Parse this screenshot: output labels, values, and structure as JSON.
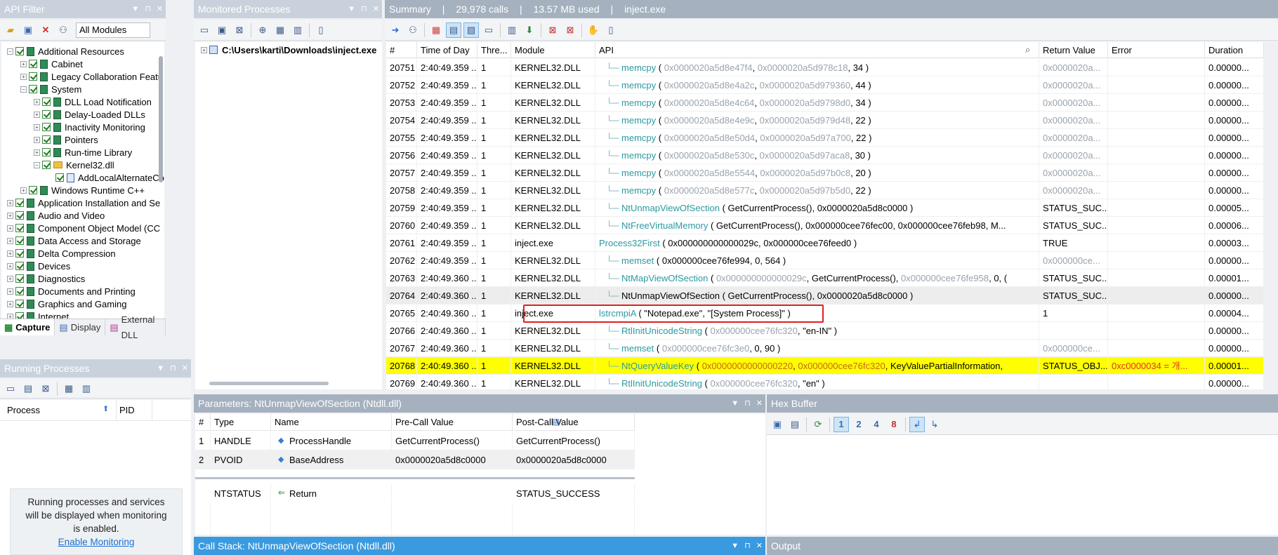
{
  "panels": {
    "api_filter": "API Filter",
    "monitored": "Monitored Processes",
    "running": "Running Processes",
    "params": "Parameters: NtUnmapViewOfSection (Ntdll.dll)",
    "hex": "Hex Buffer",
    "callstack": "Call Stack: NtUnmapViewOfSection (Ntdll.dll)",
    "output": "Output"
  },
  "summary": {
    "label": "Summary",
    "calls": "29,978 calls",
    "mem": "13.57 MB used",
    "process": "inject.exe"
  },
  "modules_select": "All Modules",
  "api_tree": [
    {
      "label": "Additional Resources",
      "kind": "book",
      "indent": 0,
      "exp": "−"
    },
    {
      "label": "Cabinet",
      "kind": "book",
      "indent": 1,
      "exp": "+"
    },
    {
      "label": "Legacy Collaboration Featu",
      "kind": "book",
      "indent": 1,
      "exp": "+"
    },
    {
      "label": "System",
      "kind": "book",
      "indent": 1,
      "exp": "−"
    },
    {
      "label": "DLL Load Notification",
      "kind": "book",
      "indent": 2,
      "exp": "+"
    },
    {
      "label": "Delay-Loaded DLLs",
      "kind": "book",
      "indent": 2,
      "exp": "+"
    },
    {
      "label": "Inactivity Monitoring",
      "kind": "book",
      "indent": 2,
      "exp": "+"
    },
    {
      "label": "Pointers",
      "kind": "book",
      "indent": 2,
      "exp": "+"
    },
    {
      "label": "Run-time Library",
      "kind": "book",
      "indent": 2,
      "exp": "+"
    },
    {
      "label": "Kernel32.dll",
      "kind": "folder",
      "indent": 2,
      "exp": "−"
    },
    {
      "label": "AddLocalAlternateCo",
      "kind": "doc",
      "indent": 3,
      "exp": ""
    },
    {
      "label": "Windows Runtime C++",
      "kind": "book",
      "indent": 1,
      "exp": "+"
    },
    {
      "label": "Application Installation and Se",
      "kind": "book",
      "indent": 0,
      "exp": "+"
    },
    {
      "label": "Audio and Video",
      "kind": "book",
      "indent": 0,
      "exp": "+"
    },
    {
      "label": "Component Object Model (CC",
      "kind": "book",
      "indent": 0,
      "exp": "+"
    },
    {
      "label": "Data Access and Storage",
      "kind": "book",
      "indent": 0,
      "exp": "+"
    },
    {
      "label": "Delta Compression",
      "kind": "book",
      "indent": 0,
      "exp": "+"
    },
    {
      "label": "Devices",
      "kind": "book",
      "indent": 0,
      "exp": "+"
    },
    {
      "label": "Diagnostics",
      "kind": "book",
      "indent": 0,
      "exp": "+"
    },
    {
      "label": "Documents and Printing",
      "kind": "book",
      "indent": 0,
      "exp": "+"
    },
    {
      "label": "Graphics and Gaming",
      "kind": "book",
      "indent": 0,
      "exp": "+"
    },
    {
      "label": "Internet",
      "kind": "book",
      "indent": 0,
      "exp": "+"
    }
  ],
  "left_tabs": [
    "Capture",
    "Display",
    "External DLL"
  ],
  "monitored_item": "C:\\Users\\karti\\Downloads\\inject.exe",
  "running": {
    "col_process": "Process",
    "col_pid": "PID",
    "message": "Running processes and services will be displayed when monitoring is enabled.",
    "link": "Enable Monitoring"
  },
  "columns": [
    "#",
    "Time of Day",
    "Thre...",
    "Module",
    "API",
    "Return Value",
    "Error",
    "Duration"
  ],
  "rows": [
    {
      "n": "20751",
      "t": "2:40:49.359 ...",
      "th": "1",
      "mod": "KERNEL32.DLL",
      "fn": "memcpy",
      "args": [
        [
          "0x0000020a5d8e47f4",
          "g"
        ],
        [
          "0x0000020a5d978c18",
          "g"
        ],
        [
          "34",
          "k"
        ]
      ],
      "ret": "0x0000020a...",
      "err": "",
      "dur": "0.00000...",
      "style": "teal",
      "nested": true
    },
    {
      "n": "20752",
      "t": "2:40:49.359 ...",
      "th": "1",
      "mod": "KERNEL32.DLL",
      "fn": "memcpy",
      "args": [
        [
          "0x0000020a5d8e4a2c",
          "g"
        ],
        [
          "0x0000020a5d979360",
          "g"
        ],
        [
          "44",
          "k"
        ]
      ],
      "ret": "0x0000020a...",
      "err": "",
      "dur": "0.00000...",
      "style": "teal",
      "nested": true
    },
    {
      "n": "20753",
      "t": "2:40:49.359 ...",
      "th": "1",
      "mod": "KERNEL32.DLL",
      "fn": "memcpy",
      "args": [
        [
          "0x0000020a5d8e4c64",
          "g"
        ],
        [
          "0x0000020a5d9798d0",
          "g"
        ],
        [
          "34",
          "k"
        ]
      ],
      "ret": "0x0000020a...",
      "err": "",
      "dur": "0.00000...",
      "style": "teal",
      "nested": true
    },
    {
      "n": "20754",
      "t": "2:40:49.359 ...",
      "th": "1",
      "mod": "KERNEL32.DLL",
      "fn": "memcpy",
      "args": [
        [
          "0x0000020a5d8e4e9c",
          "g"
        ],
        [
          "0x0000020a5d979d48",
          "g"
        ],
        [
          "22",
          "k"
        ]
      ],
      "ret": "0x0000020a...",
      "err": "",
      "dur": "0.00000...",
      "style": "teal",
      "nested": true
    },
    {
      "n": "20755",
      "t": "2:40:49.359 ...",
      "th": "1",
      "mod": "KERNEL32.DLL",
      "fn": "memcpy",
      "args": [
        [
          "0x0000020a5d8e50d4",
          "g"
        ],
        [
          "0x0000020a5d97a700",
          "g"
        ],
        [
          "22",
          "k"
        ]
      ],
      "ret": "0x0000020a...",
      "err": "",
      "dur": "0.00000...",
      "style": "teal",
      "nested": true
    },
    {
      "n": "20756",
      "t": "2:40:49.359 ...",
      "th": "1",
      "mod": "KERNEL32.DLL",
      "fn": "memcpy",
      "args": [
        [
          "0x0000020a5d8e530c",
          "g"
        ],
        [
          "0x0000020a5d97aca8",
          "g"
        ],
        [
          "30",
          "k"
        ]
      ],
      "ret": "0x0000020a...",
      "err": "",
      "dur": "0.00000...",
      "style": "teal",
      "nested": true
    },
    {
      "n": "20757",
      "t": "2:40:49.359 ...",
      "th": "1",
      "mod": "KERNEL32.DLL",
      "fn": "memcpy",
      "args": [
        [
          "0x0000020a5d8e5544",
          "g"
        ],
        [
          "0x0000020a5d97b0c8",
          "g"
        ],
        [
          "20",
          "k"
        ]
      ],
      "ret": "0x0000020a...",
      "err": "",
      "dur": "0.00000...",
      "style": "teal",
      "nested": true
    },
    {
      "n": "20758",
      "t": "2:40:49.359 ...",
      "th": "1",
      "mod": "KERNEL32.DLL",
      "fn": "memcpy",
      "args": [
        [
          "0x0000020a5d8e577c",
          "g"
        ],
        [
          "0x0000020a5d97b5d0",
          "g"
        ],
        [
          "22",
          "k"
        ]
      ],
      "ret": "0x0000020a...",
      "err": "",
      "dur": "0.00000...",
      "style": "teal",
      "nested": true
    },
    {
      "n": "20759",
      "t": "2:40:49.359 ...",
      "th": "1",
      "mod": "KERNEL32.DLL",
      "fn": "NtUnmapViewOfSection",
      "args": [
        [
          "GetCurrentProcess()",
          "k"
        ],
        [
          "0x0000020a5d8c0000",
          "k"
        ]
      ],
      "ret": "STATUS_SUC...",
      "err": "",
      "dur": "0.00005...",
      "style": "teal",
      "nested": true
    },
    {
      "n": "20760",
      "t": "2:40:49.359 ...",
      "th": "1",
      "mod": "KERNEL32.DLL",
      "fn": "NtFreeVirtualMemory",
      "args": [
        [
          "GetCurrentProcess()",
          "k"
        ],
        [
          "0x000000cee76fec00",
          "k"
        ],
        [
          "0x000000cee76feb98",
          "k"
        ],
        [
          "M...",
          "k"
        ]
      ],
      "ret": "STATUS_SUC...",
      "err": "",
      "dur": "0.00006...",
      "style": "teal",
      "nested": true
    },
    {
      "n": "20761",
      "t": "2:40:49.359 ...",
      "th": "1",
      "mod": "inject.exe",
      "fn": "Process32First",
      "args": [
        [
          "0x000000000000029c",
          "k"
        ],
        [
          "0x000000cee76feed0",
          "k"
        ]
      ],
      "ret": "TRUE",
      "err": "",
      "dur": "0.00003...",
      "style": "teal",
      "nested": false
    },
    {
      "n": "20762",
      "t": "2:40:49.359 ...",
      "th": "1",
      "mod": "KERNEL32.DLL",
      "fn": "memset",
      "args": [
        [
          "0x000000cee76fe994",
          "k"
        ],
        [
          "0",
          "k"
        ],
        [
          "564",
          "k"
        ]
      ],
      "ret": "0x000000ce...",
      "err": "",
      "dur": "0.00000...",
      "style": "teal",
      "nested": true
    },
    {
      "n": "20763",
      "t": "2:40:49.360 ...",
      "th": "1",
      "mod": "KERNEL32.DLL",
      "fn": "NtMapViewOfSection",
      "args": [
        [
          "0x000000000000029c",
          "g"
        ],
        [
          "GetCurrentProcess()",
          "k"
        ],
        [
          "0x000000cee76fe958",
          "g"
        ],
        [
          "0, (",
          "k"
        ]
      ],
      "ret": "STATUS_SUC...",
      "err": "",
      "dur": "0.00001...",
      "style": "teal",
      "nested": true
    },
    {
      "n": "20764",
      "t": "2:40:49.360 ...",
      "th": "1",
      "mod": "KERNEL32.DLL",
      "fn": "NtUnmapViewOfSection",
      "args": [
        [
          "GetCurrentProcess()",
          "k"
        ],
        [
          "0x0000020a5d8c0000",
          "k"
        ]
      ],
      "ret": "STATUS_SUC...",
      "err": "",
      "dur": "0.00000...",
      "style": "sel",
      "nested": true
    },
    {
      "n": "20765",
      "t": "2:40:49.360 ...",
      "th": "1",
      "mod": "inject.exe",
      "fn": "lstrcmpiA",
      "args": [
        [
          "\"Notepad.exe\"",
          "k"
        ],
        [
          "\"[System Process]\"",
          "k"
        ]
      ],
      "ret": "1",
      "err": "",
      "dur": "0.00004...",
      "style": "teal",
      "nested": false
    },
    {
      "n": "20766",
      "t": "2:40:49.360 ...",
      "th": "1",
      "mod": "KERNEL32.DLL",
      "fn": "RtlInitUnicodeString",
      "args": [
        [
          "0x000000cee76fc320",
          "g"
        ],
        [
          "\"en-IN\"",
          "k"
        ]
      ],
      "ret": "",
      "err": "",
      "dur": "0.00000...",
      "style": "teal",
      "nested": true
    },
    {
      "n": "20767",
      "t": "2:40:49.360 ...",
      "th": "1",
      "mod": "KERNEL32.DLL",
      "fn": "memset",
      "args": [
        [
          "0x000000cee76fc3e0",
          "g"
        ],
        [
          "0",
          "k"
        ],
        [
          "90",
          "k"
        ]
      ],
      "ret": "0x000000ce...",
      "err": "",
      "dur": "0.00000...",
      "style": "teal",
      "nested": true
    },
    {
      "n": "20768",
      "t": "2:40:49.360 ...",
      "th": "1",
      "mod": "KERNEL32.DLL",
      "fn": "NtQueryValueKey",
      "args": [
        [
          "0x0000000000000220",
          "o"
        ],
        [
          "0x000000cee76fc320",
          "o"
        ],
        [
          "KeyValuePartialInformation,",
          "k"
        ]
      ],
      "ret": "STATUS_OBJ...",
      "err": "0xc0000034 = 개...",
      "dur": "0.00001...",
      "style": "yellow",
      "nested": true
    },
    {
      "n": "20769",
      "t": "2:40:49.360 ...",
      "th": "1",
      "mod": "KERNEL32.DLL",
      "fn": "RtlInitUnicodeString",
      "args": [
        [
          "0x000000cee76fc320",
          "g"
        ],
        [
          "\"en\"",
          "k"
        ]
      ],
      "ret": "",
      "err": "",
      "dur": "0.00000...",
      "style": "teal",
      "nested": true
    }
  ],
  "param_columns": [
    "#",
    "Type",
    "Name",
    "Pre-Call Value",
    "Post-Call Value"
  ],
  "param_rows": [
    {
      "n": "1",
      "type": "HANDLE",
      "name": "ProcessHandle",
      "pre": "GetCurrentProcess()",
      "post": "GetCurrentProcess()"
    },
    {
      "n": "2",
      "type": "PVOID",
      "name": "BaseAddress",
      "pre": "0x0000020a5d8c0000",
      "post": "0x0000020a5d8c0000"
    }
  ],
  "param_return": {
    "type": "NTSTATUS",
    "name": "Return",
    "post": "STATUS_SUCCESS"
  },
  "hex_buttons": [
    "1",
    "2",
    "4",
    "8"
  ]
}
